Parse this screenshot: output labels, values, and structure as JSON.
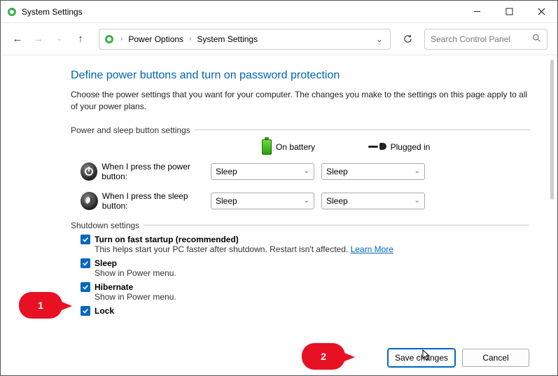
{
  "titlebar": {
    "title": "System Settings"
  },
  "breadcrumb": {
    "root": "Power Options",
    "current": "System Settings"
  },
  "search": {
    "placeholder": "Search Control Panel"
  },
  "heading": "Define power buttons and turn on password protection",
  "subtext": "Choose the power settings that you want for your computer. The changes you make to the settings on this page apply to all of your power plans.",
  "groups": {
    "power_sleep": {
      "title": "Power and sleep button settings",
      "col_battery": "On battery",
      "col_plugged": "Plugged in",
      "rows": [
        {
          "label": "When I press the power button:",
          "battery": "Sleep",
          "plugged": "Sleep"
        },
        {
          "label": "When I press the sleep button:",
          "battery": "Sleep",
          "plugged": "Sleep"
        }
      ]
    },
    "shutdown": {
      "title": "Shutdown settings",
      "items": [
        {
          "label": "Turn on fast startup (recommended)",
          "desc": "This helps start your PC faster after shutdown. Restart isn't affected.",
          "link": "Learn More"
        },
        {
          "label": "Sleep",
          "desc": "Show in Power menu."
        },
        {
          "label": "Hibernate",
          "desc": "Show in Power menu."
        },
        {
          "label": "Lock",
          "desc": ""
        }
      ]
    }
  },
  "footer": {
    "save": "Save changes",
    "cancel": "Cancel"
  },
  "callouts": {
    "one": "1",
    "two": "2"
  }
}
